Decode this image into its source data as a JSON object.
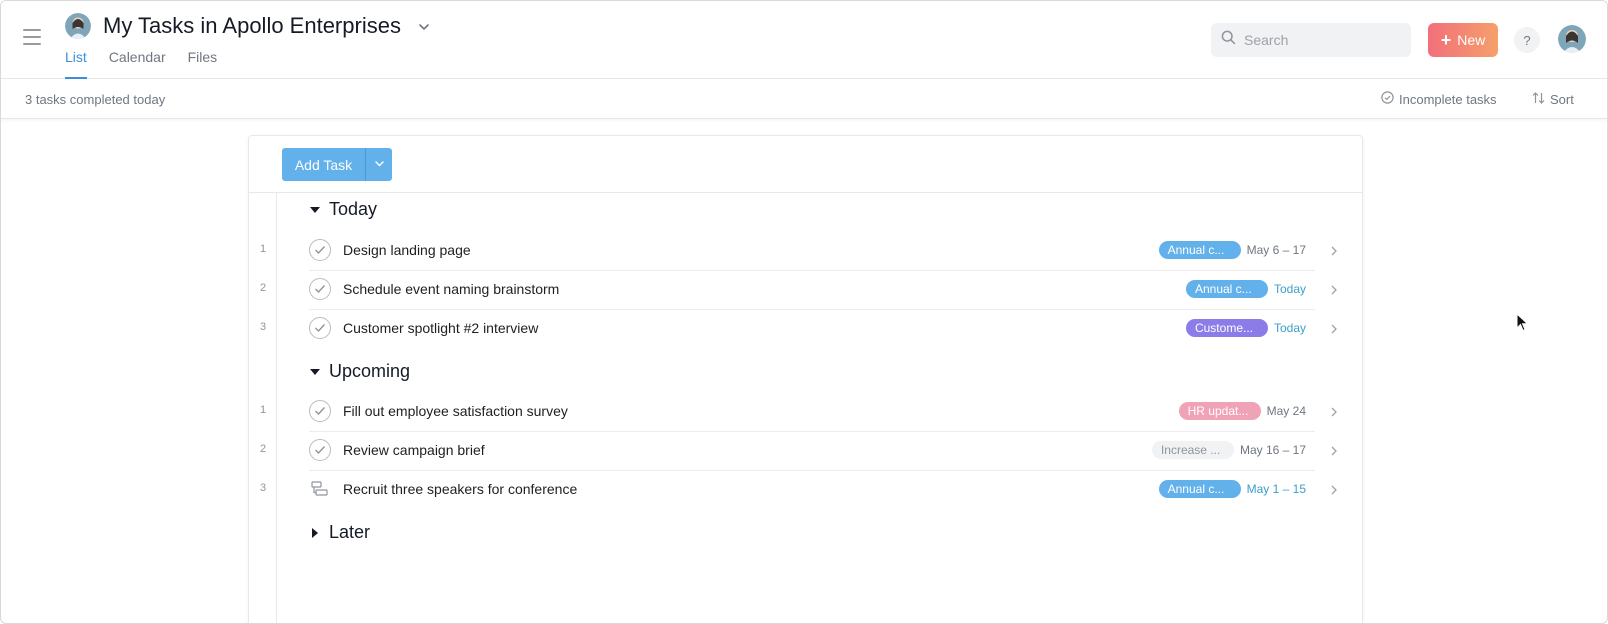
{
  "header": {
    "title": "My Tasks in Apollo Enterprises",
    "tabs": [
      {
        "label": "List"
      },
      {
        "label": "Calendar"
      },
      {
        "label": "Files"
      }
    ],
    "search_placeholder": "Search",
    "new_label": "New",
    "help_label": "?"
  },
  "toolbar": {
    "completed_text": "3 tasks completed today",
    "incomplete_label": "Incomplete tasks",
    "sort_label": "Sort"
  },
  "panel": {
    "add_task_label": "Add Task"
  },
  "sections": {
    "today": {
      "label": "Today",
      "tasks": [
        {
          "num": "1",
          "name": "Design landing page",
          "tag": "Annual c...",
          "tag_color": "#62b1ea",
          "date": "May 6 – 17"
        },
        {
          "num": "2",
          "name": "Schedule event naming brainstorm",
          "tag": "Annual c...",
          "tag_color": "#62b1ea",
          "date": "Today"
        },
        {
          "num": "3",
          "name": "Customer spotlight #2 interview",
          "tag": "Custome...",
          "tag_color": "#8b7cea",
          "date": "Today"
        }
      ]
    },
    "upcoming": {
      "label": "Upcoming",
      "tasks": [
        {
          "num": "1",
          "name": "Fill out employee satisfaction survey",
          "tag": "HR updat...",
          "tag_color": "#f0a3b6",
          "date": "May 24"
        },
        {
          "num": "2",
          "name": "Review campaign brief",
          "tag": "Increase ...",
          "tag_color": "#f1f2f4",
          "date": "May 16 – 17"
        },
        {
          "num": "3",
          "name": "Recruit three speakers for conference",
          "tag": "Annual c...",
          "tag_color": "#62b1ea",
          "date": "May 1 – 15"
        }
      ]
    },
    "later": {
      "label": "Later"
    }
  },
  "colors": {
    "accent": "#3e8ddd",
    "add_task": "#62b1ea",
    "new_gradient_start": "#f26f7a",
    "new_gradient_end": "#f5a06b",
    "date_today": "#3aa0c9"
  },
  "icons": {
    "menu": "hamburger-icon",
    "search": "search-icon",
    "check": "check-icon",
    "milestone": "milestone-icon",
    "chevron": "chevron-right-icon",
    "sort": "sort-icon"
  }
}
